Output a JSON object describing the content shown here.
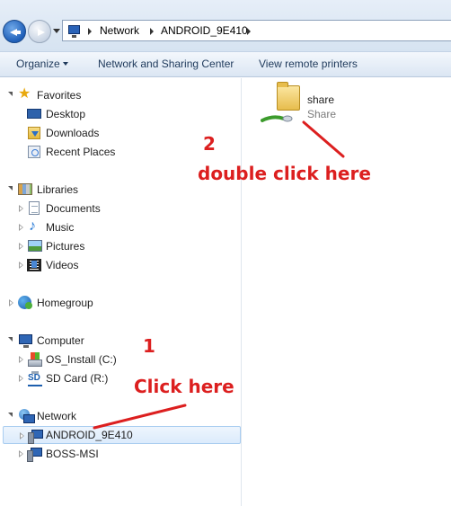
{
  "address_bar": {
    "breadcrumbs": [
      "Network",
      "ANDROID_9E410"
    ]
  },
  "toolbar": {
    "organize_label": "Organize",
    "network_sharing_label": "Network and Sharing Center",
    "view_printers_label": "View remote printers"
  },
  "nav": {
    "favorites": {
      "label": "Favorites",
      "items": [
        "Desktop",
        "Downloads",
        "Recent Places"
      ]
    },
    "libraries": {
      "label": "Libraries",
      "items": [
        "Documents",
        "Music",
        "Pictures",
        "Videos"
      ]
    },
    "homegroup": {
      "label": "Homegroup"
    },
    "computer": {
      "label": "Computer",
      "items": [
        "OS_Install (C:)",
        "SD Card (R:)"
      ]
    },
    "network": {
      "label": "Network",
      "items": [
        "ANDROID_9E410",
        "BOSS-MSI"
      ],
      "selected": "ANDROID_9E410"
    }
  },
  "content": {
    "items": [
      {
        "name": "share",
        "type": "Share"
      }
    ]
  },
  "annotations": {
    "step1_number": "1",
    "step1_text": "Click here",
    "step2_number": "2",
    "step2_text": "double click here",
    "color": "#dc1f1f"
  },
  "icons": {
    "favorites": "star-icon",
    "desktop": "desktop-icon",
    "downloads": "downloads-icon",
    "recent": "recent-places-icon",
    "libraries": "libraries-icon",
    "documents": "documents-icon",
    "music": "music-icon",
    "pictures": "pictures-icon",
    "videos": "videos-icon",
    "homegroup": "homegroup-icon",
    "computer": "computer-icon",
    "drive_c": "hard-drive-icon",
    "sd_card": "sd-card-icon",
    "network": "network-icon",
    "network_pc": "network-computer-icon",
    "share": "shared-folder-icon"
  }
}
